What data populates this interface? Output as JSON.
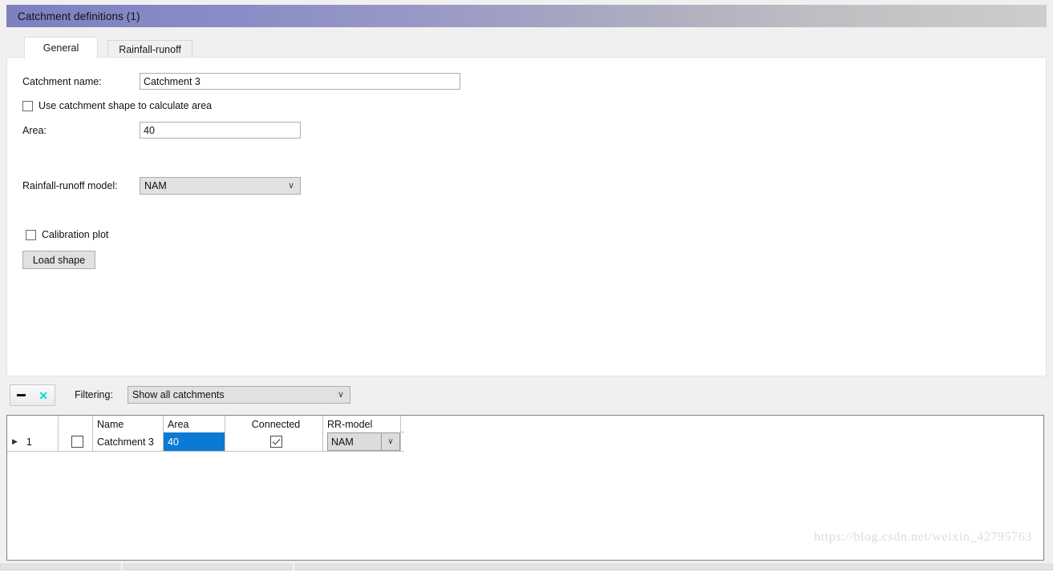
{
  "window": {
    "title": "Catchment definitions (1)",
    "title_gradient_start": "#7e7fc0",
    "title_gradient_end": "#cdcdcd"
  },
  "tabs": [
    {
      "label": "General",
      "active": true
    },
    {
      "label": "Rainfall-runoff",
      "active": false
    }
  ],
  "general_tab": {
    "catchment_name": {
      "label": "Catchment name:",
      "value": "Catchment 3"
    },
    "use_shape_checkbox": {
      "label": "Use catchment shape to calculate area",
      "checked": false
    },
    "area": {
      "label": "Area:",
      "value": "40"
    },
    "rr_model": {
      "label": "Rainfall-runoff model:",
      "value": "NAM",
      "chevron": "∨"
    },
    "calibration_plot": {
      "label": "Calibration plot",
      "checked": false
    },
    "load_shape_button": {
      "label": "Load shape"
    }
  },
  "filter_bar": {
    "minus_icon": "minus-icon",
    "close_icon": "✕",
    "close_icon_color": "#00d8d8",
    "filtering_label": "Filtering:",
    "filter_value": "Show all catchments",
    "chevron": "∨"
  },
  "grid": {
    "columns": [
      "",
      "",
      "Name",
      "Area",
      "Connected",
      "RR-model"
    ],
    "rows": [
      {
        "indicator": "▶",
        "row_number": "1",
        "select_checked": false,
        "name": "Catchment 3",
        "area": "40",
        "area_selected": true,
        "connected": true,
        "rr_model": "NAM",
        "rr_chevron": "∨"
      }
    ],
    "selection_color": "#0a7ad4"
  },
  "watermark": {
    "text": "https://blog.csdn.net/weixin_42795763"
  }
}
